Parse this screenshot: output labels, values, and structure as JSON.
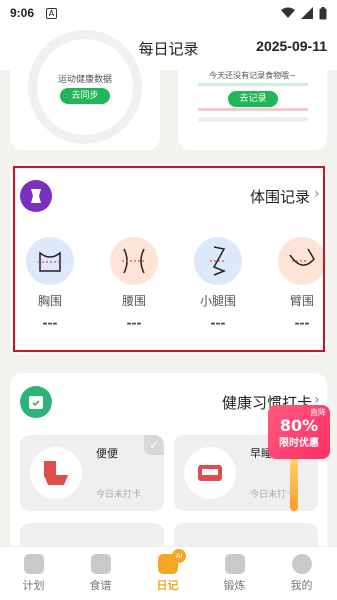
{
  "status_bar": {
    "time": "9:06",
    "a_glyph": "A"
  },
  "header": {
    "title": "每日记录",
    "date": "2025-09-11"
  },
  "top_cards": {
    "sport": {
      "text": "运动健康数据",
      "button": "去同步"
    },
    "food": {
      "text": "今天还没有记录食物哦~",
      "button": "去记录"
    }
  },
  "body_record": {
    "title": "体围记录",
    "items": [
      {
        "label": "胸围",
        "value": "---"
      },
      {
        "label": "腰围",
        "value": "---"
      },
      {
        "label": "小腿围",
        "value": "---"
      },
      {
        "label": "臂围",
        "value": "---"
      }
    ]
  },
  "habit": {
    "title": "健康习惯打卡",
    "tiles": [
      {
        "name": "便便",
        "status": "今日未打卡"
      },
      {
        "name": "早睡",
        "status": "今日未打卡"
      }
    ]
  },
  "promo": {
    "top": "直降",
    "percent": "80%",
    "text": "限时优惠"
  },
  "nav": {
    "items": [
      {
        "label": "计划"
      },
      {
        "label": "食谱"
      },
      {
        "label": "日记",
        "badge": "AI"
      },
      {
        "label": "锻炼"
      },
      {
        "label": "我的"
      }
    ],
    "active_color": "#f5a623"
  },
  "colors": {
    "accent_green": "#21b657",
    "purple": "#7b2fbe",
    "highlight_red": "#d40f1f"
  }
}
